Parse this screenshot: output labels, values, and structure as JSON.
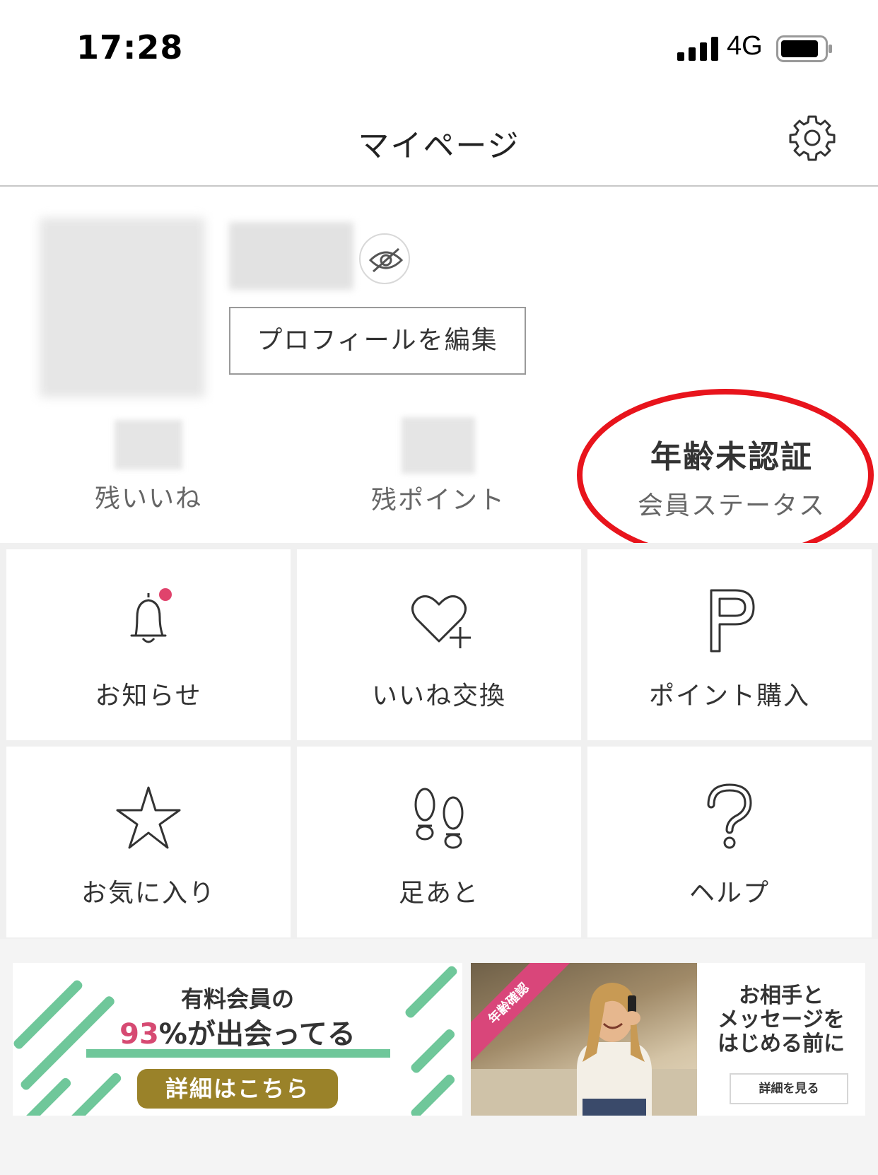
{
  "status_bar": {
    "time": "17:28",
    "network": "4G"
  },
  "header": {
    "title": "マイページ"
  },
  "profile": {
    "edit_profile_label": "プロフィールを編集",
    "stats": [
      {
        "label": "残いいね"
      },
      {
        "label": "残ポイント"
      },
      {
        "value": "年齢未認証",
        "label": "会員ステータス"
      }
    ]
  },
  "menu": {
    "tiles": [
      {
        "label": "お知らせ",
        "icon": "bell-icon",
        "has_badge": true
      },
      {
        "label": "いいね交換",
        "icon": "heart-plus-icon"
      },
      {
        "label": "ポイント購入",
        "icon": "point-p-icon"
      },
      {
        "label": "お気に入り",
        "icon": "star-icon"
      },
      {
        "label": "足あと",
        "icon": "footprints-icon"
      },
      {
        "label": "ヘルプ",
        "icon": "question-icon"
      }
    ]
  },
  "banners": {
    "left": {
      "line1": "有料会員の",
      "percent": "93",
      "percent_suffix": "%が出会ってる",
      "button_label": "詳細はこちら"
    },
    "right": {
      "ribbon": "年齢確認",
      "text_line1": "お相手と",
      "text_line2": "メッセージを",
      "text_line3": "はじめる前に",
      "button_label": "詳細を見る"
    }
  },
  "colors": {
    "badge": "#e0436c",
    "annotation": "#e8141c",
    "stripe": "#6fc79a",
    "button_gold": "#9a8229",
    "ribbon": "#d9467a"
  }
}
